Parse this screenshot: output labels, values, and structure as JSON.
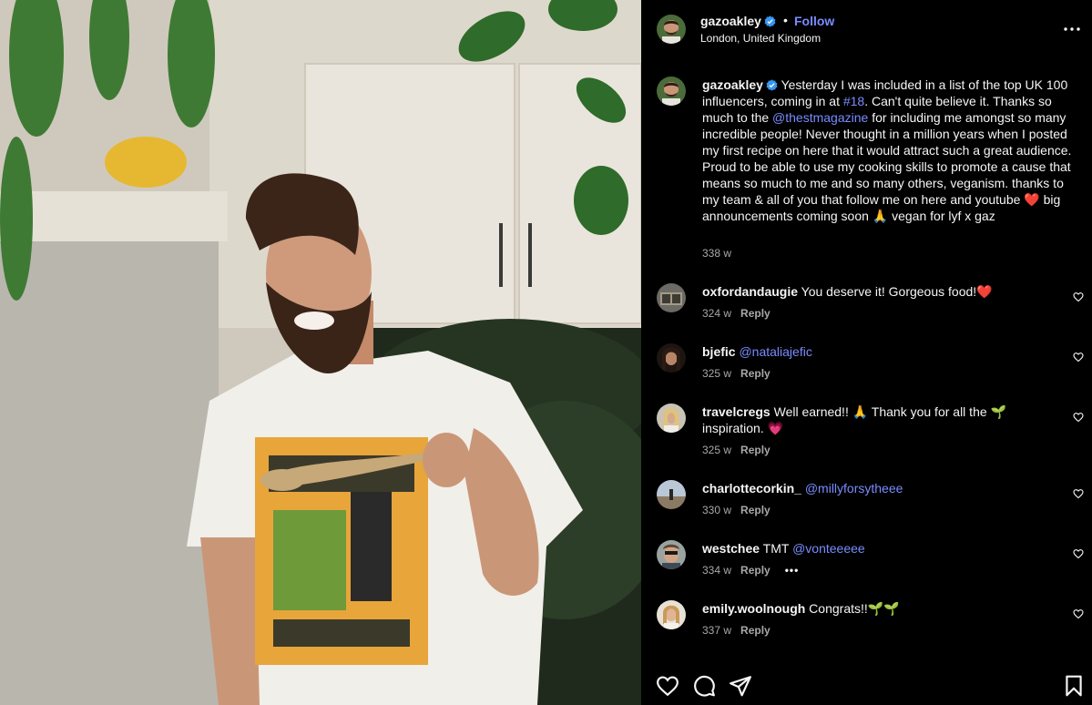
{
  "post": {
    "username": "gazoakley",
    "location": "London, United Kingdom",
    "follow_label": "Follow",
    "separator": "•",
    "verified_color": "#3897f0"
  },
  "caption": {
    "username": "gazoakley",
    "text_1": " Yesterday I was included in a list of the top UK 100 influencers, coming in at ",
    "hashtag": "#18",
    "text_2": ". Can't quite believe it. Thanks so much to the ",
    "mention": "@thestmagazine",
    "text_3": " for including me amongst so many incredible people! Never thought in a million years when I posted my first recipe on here that it would attract such a great audience. Proud to be able to use my cooking skills to promote a cause that means so much to me and so many others, veganism. thanks to my team & all of you that follow me on here and youtube ❤️ big announcements coming soon 🙏 vegan for lyf x gaz",
    "time": "338 w"
  },
  "comments": [
    {
      "username": "oxfordandaugie",
      "text": " You deserve it! Gorgeous food!❤️",
      "mention": "",
      "time": "324 w",
      "reply": "Reply"
    },
    {
      "username": "bjefic",
      "text": " ",
      "mention": "@nataliajefic",
      "time": "325 w",
      "reply": "Reply"
    },
    {
      "username": "travelcregs",
      "text": " Well earned!! 🙏 Thank you for all the 🌱 inspiration. 💗",
      "mention": "",
      "time": "325 w",
      "reply": "Reply"
    },
    {
      "username": "charlottecorkin_",
      "text": " ",
      "mention": "@millyforsytheee",
      "time": "330 w",
      "reply": "Reply"
    },
    {
      "username": "westchee",
      "text": " TMT ",
      "mention": "@vonteeeee",
      "time": "334 w",
      "reply": "Reply",
      "more": "•••"
    },
    {
      "username": "emily.woolnough",
      "text": " Congrats!!🌱🌱",
      "mention": "",
      "time": "337 w",
      "reply": "Reply"
    }
  ],
  "colors": {
    "background": "#000000",
    "text": "#f5f5f5",
    "secondary_text": "#a8a8a8",
    "link": "#7a8cff"
  },
  "icons": {
    "more": "more-horizontal-icon",
    "like": "heart-icon",
    "comment": "comment-icon",
    "share": "share-icon",
    "save": "bookmark-icon"
  }
}
